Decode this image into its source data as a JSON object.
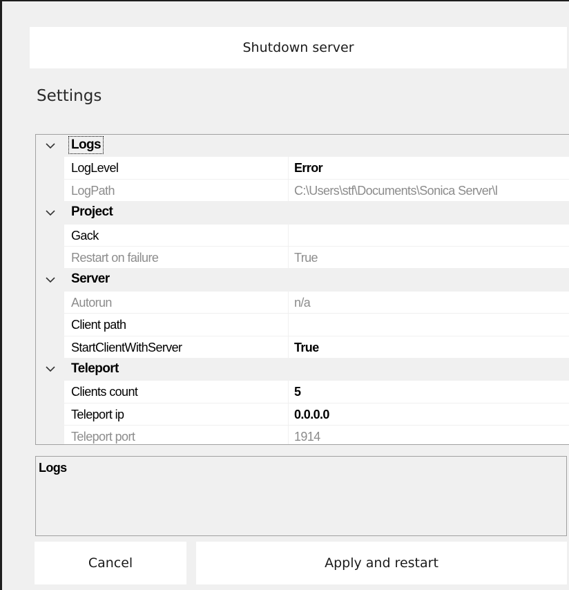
{
  "toolbar": {
    "shutdown_label": "Shutdown server"
  },
  "settings": {
    "title": "Settings"
  },
  "grid": {
    "categories": [
      {
        "label": "Logs",
        "properties": [
          {
            "name": "LogLevel",
            "value": "Error",
            "bold": true,
            "dim": false
          },
          {
            "name": "LogPath",
            "value": "C:\\Users\\stf\\Documents\\Sonica Server\\l",
            "bold": false,
            "dim": true
          }
        ]
      },
      {
        "label": "Project",
        "properties": [
          {
            "name": "Gack",
            "value": "",
            "bold": false,
            "dim": false
          },
          {
            "name": "Restart on failure",
            "value": "True",
            "bold": false,
            "dim": true
          }
        ]
      },
      {
        "label": "Server",
        "properties": [
          {
            "name": "Autorun",
            "value": "n/a",
            "bold": false,
            "dim": true
          },
          {
            "name": "Client path",
            "value": "",
            "bold": false,
            "dim": false
          },
          {
            "name": "StartClientWithServer",
            "value": "True",
            "bold": true,
            "dim": false
          }
        ]
      },
      {
        "label": "Teleport",
        "properties": [
          {
            "name": "Clients count",
            "value": "5",
            "bold": true,
            "dim": false
          },
          {
            "name": "Teleport ip",
            "value": "0.0.0.0",
            "bold": true,
            "dim": false
          },
          {
            "name": "Teleport port",
            "value": "1914",
            "bold": false,
            "dim": true
          }
        ]
      }
    ]
  },
  "description": {
    "title": "Logs"
  },
  "footer": {
    "cancel_label": "Cancel",
    "apply_label": "Apply and restart"
  },
  "colors": {
    "panel_bg": "#f0f0f0",
    "grid_bg": "#ffffff",
    "dim_text": "#8c8c8c",
    "border": "#a0a0a0"
  },
  "icons": {
    "category_toggle": "chevron-down-icon"
  }
}
